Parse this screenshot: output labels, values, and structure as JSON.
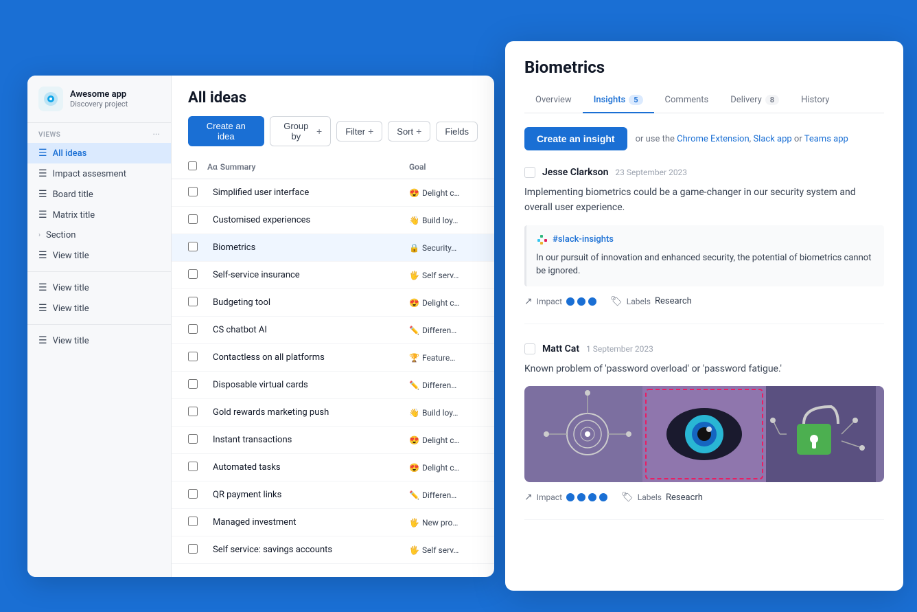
{
  "app": {
    "name": "Awesome app",
    "subtitle": "Discovery project",
    "icon": "🎯"
  },
  "sidebar": {
    "views_label": "VIEWS",
    "items": [
      {
        "label": "All ideas",
        "active": true,
        "icon": "list"
      },
      {
        "label": "Impact assesment",
        "active": false,
        "icon": "list"
      },
      {
        "label": "Board title",
        "active": false,
        "icon": "list"
      },
      {
        "label": "Matrix title",
        "active": false,
        "icon": "list"
      },
      {
        "label": "Section",
        "active": false,
        "icon": "chevron",
        "type": "section"
      },
      {
        "label": "View title",
        "active": false,
        "icon": "list"
      },
      {
        "label": "View title",
        "active": false,
        "icon": "list"
      },
      {
        "label": "View title",
        "active": false,
        "icon": "list"
      },
      {
        "label": "View title",
        "active": false,
        "icon": "list"
      }
    ]
  },
  "main": {
    "title": "All ideas",
    "toolbar": {
      "create_idea": "Create an idea",
      "group_by": "Group by",
      "filter": "Filter",
      "sort": "Sort",
      "fields": "Fields"
    },
    "table": {
      "columns": [
        {
          "label": "Aα Summary",
          "key": "summary"
        },
        {
          "label": "Goal",
          "key": "goal"
        }
      ],
      "rows": [
        {
          "summary": "Simplified user interface",
          "goal": "Delight c",
          "emoji": "😍",
          "active": false
        },
        {
          "summary": "Customised experiences",
          "goal": "Build loy",
          "emoji": "👋",
          "active": false
        },
        {
          "summary": "Biometrics",
          "goal": "Security",
          "emoji": "🔒",
          "active": true
        },
        {
          "summary": "Self-service insurance",
          "goal": "Self serv",
          "emoji": "🖐️",
          "active": false
        },
        {
          "summary": "Budgeting tool",
          "goal": "Delight c",
          "emoji": "😍",
          "active": false
        },
        {
          "summary": "CS chatbot AI",
          "goal": "Differen",
          "emoji": "✏️",
          "active": false
        },
        {
          "summary": "Contactless on all platforms",
          "goal": "Feature",
          "emoji": "🏆",
          "active": false
        },
        {
          "summary": "Disposable virtual cards",
          "goal": "Differen",
          "emoji": "✏️",
          "active": false
        },
        {
          "summary": "Gold rewards marketing push",
          "goal": "Build loy",
          "emoji": "👋",
          "active": false
        },
        {
          "summary": "Instant transactions",
          "goal": "Delight c",
          "emoji": "😍",
          "active": false
        },
        {
          "summary": "Automated tasks",
          "goal": "Delight c",
          "emoji": "😍",
          "active": false
        },
        {
          "summary": "QR payment links",
          "goal": "Differen",
          "emoji": "✏️",
          "active": false
        },
        {
          "summary": "Managed investment",
          "goal": "New pro",
          "emoji": "🖐️",
          "active": false
        },
        {
          "summary": "Self service: savings accounts",
          "goal": "Self serv",
          "emoji": "🖐️",
          "active": false
        }
      ]
    }
  },
  "insight_panel": {
    "title": "Biometrics",
    "tabs": [
      {
        "label": "Overview",
        "active": false
      },
      {
        "label": "Insights",
        "count": "5",
        "active": true
      },
      {
        "label": "Comments",
        "active": false
      },
      {
        "label": "Delivery",
        "count": "8",
        "active": false
      },
      {
        "label": "History",
        "active": false
      }
    ],
    "create_insight_label": "Create an insight",
    "create_insight_or": "or use the",
    "chrome_extension": "Chrome Extension",
    "slack_app": "Slack app",
    "teams_app": "Teams app",
    "or_text": "or",
    "insights": [
      {
        "user": "Jesse Clarkson",
        "date": "23 September 2023",
        "text": "Implementing biometrics could be a game-changer in our security system and overall user experience.",
        "has_quote": true,
        "quote_channel": "#slack-insights",
        "quote_text": "In our pursuit of innovation and enhanced security, the potential of biometrics cannot be ignored.",
        "impact_dots": 3,
        "labels_label": "Labels",
        "labels_value": "Research",
        "has_image": false
      },
      {
        "user": "Matt Cat",
        "date": "1 September 2023",
        "text": "Known problem of 'password overload' or 'password fatigue.'",
        "has_quote": false,
        "impact_dots": 4,
        "labels_label": "Labels",
        "labels_value": "Reseacrh",
        "has_image": true
      }
    ]
  }
}
